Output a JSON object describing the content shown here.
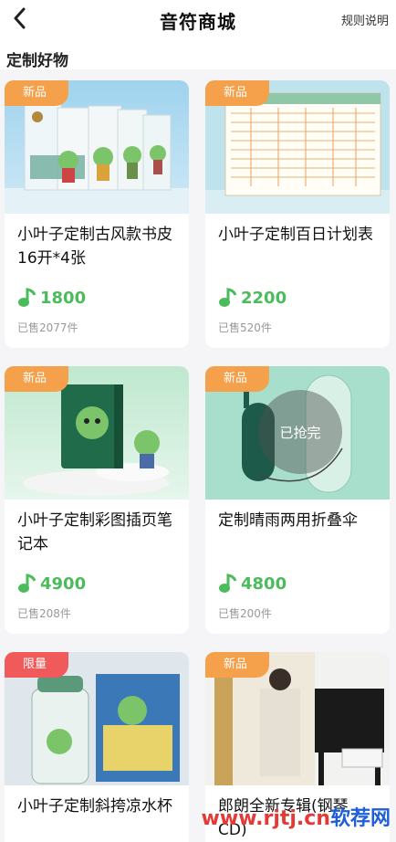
{
  "header": {
    "back_icon": "chevron-left-icon",
    "title": "音符商城",
    "rules_label": "规则说明"
  },
  "section_title": "定制好物",
  "products": [
    {
      "badge": "新品",
      "name": "小叶子定制古风款书皮16开*4张",
      "price": "1800",
      "sold": "已售2077件"
    },
    {
      "badge": "新品",
      "name": "小叶子定制百日计划表",
      "price": "2200",
      "sold": "已售520件"
    },
    {
      "badge": "新品",
      "name": "小叶子定制彩图插页笔记本",
      "price": "4900",
      "sold": "已售208件"
    },
    {
      "badge": "新品",
      "name": "定制晴雨两用折叠伞",
      "price": "4800",
      "sold": "已售200件",
      "soldout": "已抢完"
    },
    {
      "badge": "限量",
      "name": "小叶子定制斜挎凉水杯",
      "price": "",
      "sold": ""
    },
    {
      "badge": "新品",
      "name": "郎朗全新专辑(钢琴CD)",
      "price": "",
      "sold": ""
    }
  ],
  "colors": {
    "price_green": "#4cbb5c",
    "badge_orange": "#f5a04a",
    "badge_red": "#f05a5a"
  },
  "watermark": {
    "part1": "www.rjtj.cn",
    "part2": "软荐网"
  }
}
